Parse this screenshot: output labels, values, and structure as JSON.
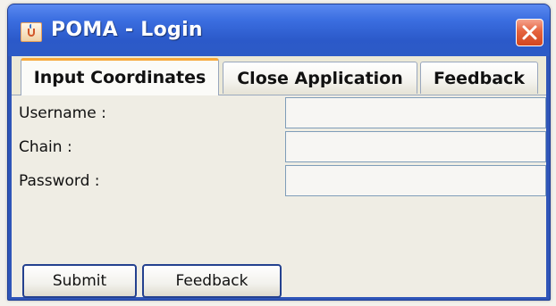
{
  "window": {
    "title": "POMA - Login",
    "app_icon": "java-cup-icon",
    "close_icon": "close-icon"
  },
  "tabs": [
    {
      "label": "Input Coordinates",
      "selected": true
    },
    {
      "label": "Close Application",
      "selected": false
    },
    {
      "label": "Feedback",
      "selected": false
    }
  ],
  "form": {
    "username": {
      "label": "Username :",
      "value": ""
    },
    "chain": {
      "label": "Chain :",
      "value": ""
    },
    "password": {
      "label": "Password :",
      "value": ""
    }
  },
  "buttons": {
    "submit_label": "Submit",
    "feedback_label": "Feedback"
  },
  "colors": {
    "titlebar": "#2b59c9",
    "active_tab_accent": "#f7a93b",
    "close_button": "#d2451f",
    "button_border": "#24418f"
  }
}
